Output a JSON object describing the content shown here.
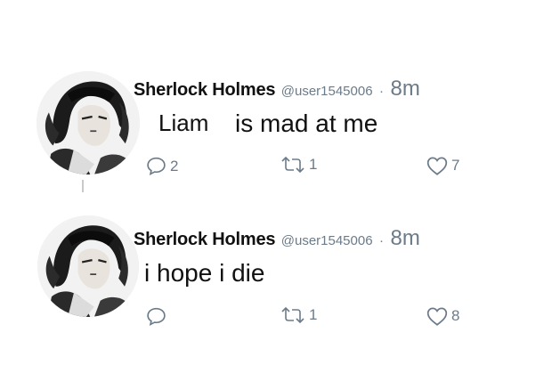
{
  "tweets": [
    {
      "author": {
        "name": "Sherlock Holmes",
        "handle": "@user1545006",
        "separator": "·",
        "time": "8m"
      },
      "text_parts": [
        "Liam",
        "is mad at me"
      ],
      "actions": {
        "reply_count": "2",
        "retweet_count": "1",
        "like_count": "7"
      }
    },
    {
      "author": {
        "name": "Sherlock Holmes",
        "handle": "@user1545006",
        "separator": "·",
        "time": "8m"
      },
      "text": "i hope i die",
      "actions": {
        "reply_count": "",
        "retweet_count": "1",
        "like_count": "8"
      }
    }
  ],
  "icons": {
    "reply": "speech-bubble-icon",
    "retweet": "retweet-arrows-icon",
    "like": "heart-outline-icon"
  },
  "colors": {
    "muted": "#6b7b8a",
    "text": "#111111",
    "background": "#ffffff"
  }
}
